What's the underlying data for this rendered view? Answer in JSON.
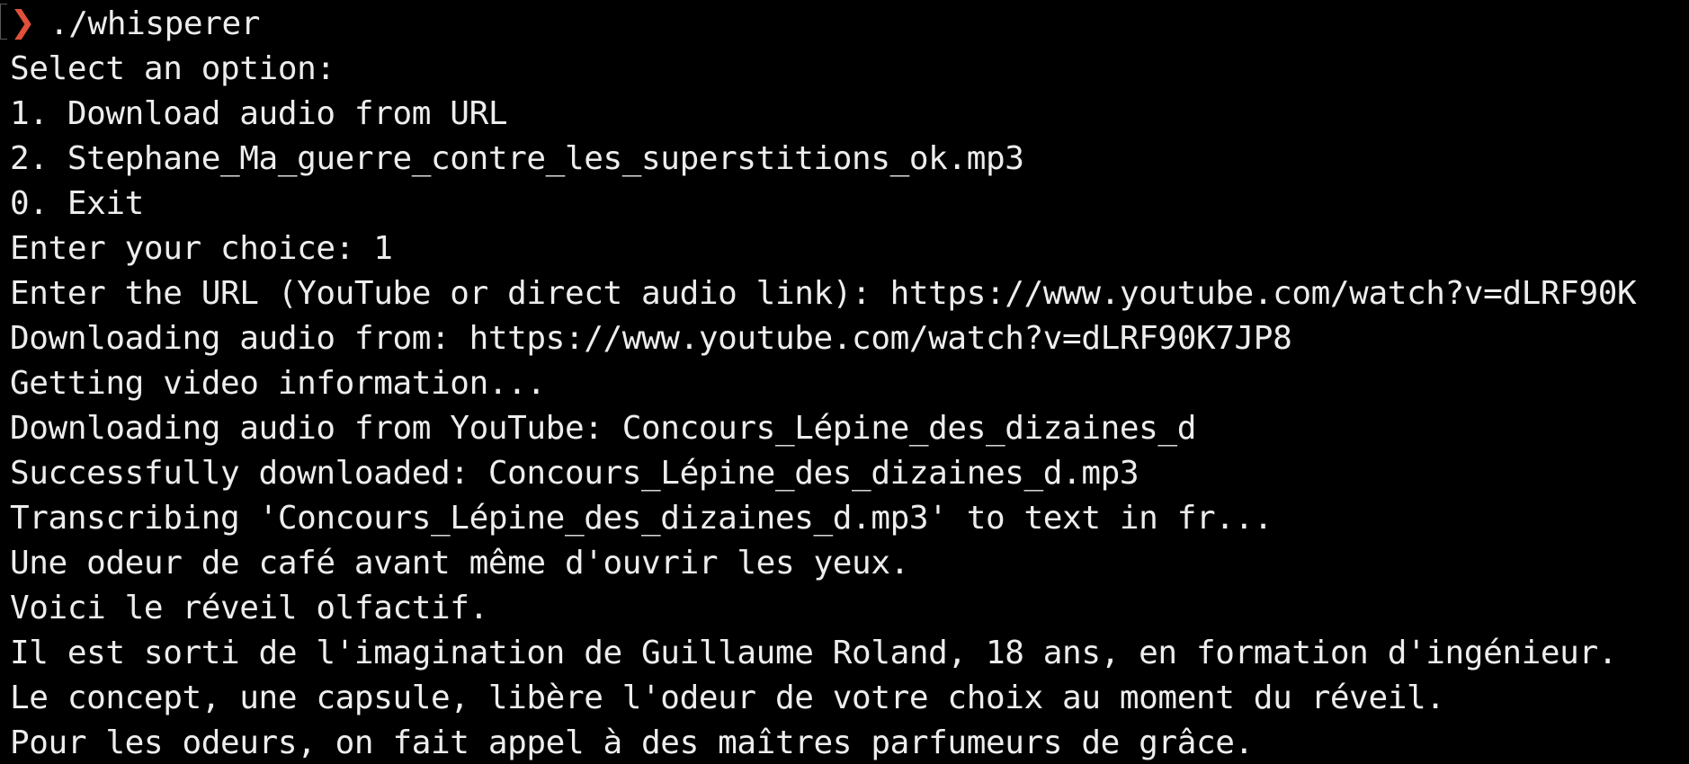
{
  "prompt": {
    "symbol": "❯",
    "symbol_color": "#e0503a",
    "command": "./whisperer"
  },
  "output_lines": [
    "Select an option:",
    "1. Download audio from URL",
    "2. Stephane_Ma_guerre_contre_les_superstitions_ok.mp3",
    "0. Exit",
    "Enter your choice: 1",
    "Enter the URL (YouTube or direct audio link): https://www.youtube.com/watch?v=dLRF90K",
    "Downloading audio from: https://www.youtube.com/watch?v=dLRF90K7JP8",
    "Getting video information...",
    "Downloading audio from YouTube: Concours_Lépine_des_dizaines_d",
    "Successfully downloaded: Concours_Lépine_des_dizaines_d.mp3",
    "Transcribing 'Concours_Lépine_des_dizaines_d.mp3' to text in fr...",
    "Une odeur de café avant même d'ouvrir les yeux.",
    "Voici le réveil olfactif.",
    "Il est sorti de l'imagination de Guillaume Roland, 18 ans, en formation d'ingénieur.",
    "Le concept, une capsule, libère l'odeur de votre choix au moment du réveil.",
    "Pour les odeurs, on fait appel à des maîtres parfumeurs de grâce."
  ],
  "colors": {
    "background": "#000000",
    "foreground": "#ededed"
  }
}
